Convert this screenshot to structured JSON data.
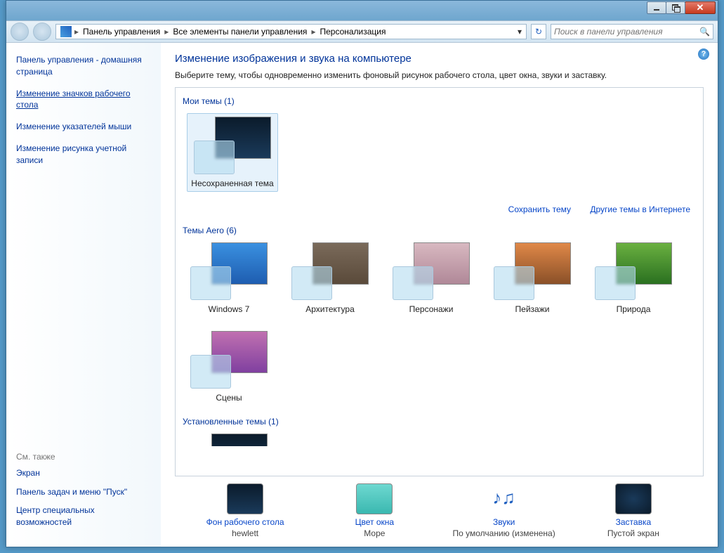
{
  "breadcrumb": [
    "Панель управления",
    "Все элементы панели управления",
    "Персонализация"
  ],
  "search_placeholder": "Поиск в панели управления",
  "sidebar": {
    "head": "Панель управления - домашняя страница",
    "links": [
      "Изменение значков рабочего стола",
      "Изменение указателей мыши",
      "Изменение рисунка учетной записи"
    ],
    "see_also_title": "См. также",
    "see_also": [
      "Экран",
      "Панель задач и меню \"Пуск\"",
      "Центр специальных возможностей"
    ]
  },
  "main": {
    "title": "Изменение изображения и звука на компьютере",
    "subtitle": "Выберите тему, чтобы одновременно изменить фоновый рисунок рабочего стола, цвет окна, звуки и заставку.",
    "groups": {
      "my": {
        "title": "Мои темы (1)",
        "items": [
          "Несохраненная тема"
        ]
      },
      "aero": {
        "title": "Темы Aero (6)",
        "items": [
          "Windows 7",
          "Архитектура",
          "Персонажи",
          "Пейзажи",
          "Природа",
          "Сцены"
        ]
      },
      "installed": {
        "title": "Установленные темы (1)"
      }
    },
    "actions": {
      "save": "Сохранить тему",
      "more": "Другие темы в Интернете"
    }
  },
  "bottom": {
    "wall": {
      "title": "Фон рабочего стола",
      "value": "hewlett"
    },
    "color": {
      "title": "Цвет окна",
      "value": "Море"
    },
    "sound": {
      "title": "Звуки",
      "value": "По умолчанию (изменена)"
    },
    "ss": {
      "title": "Заставка",
      "value": "Пустой экран"
    }
  }
}
